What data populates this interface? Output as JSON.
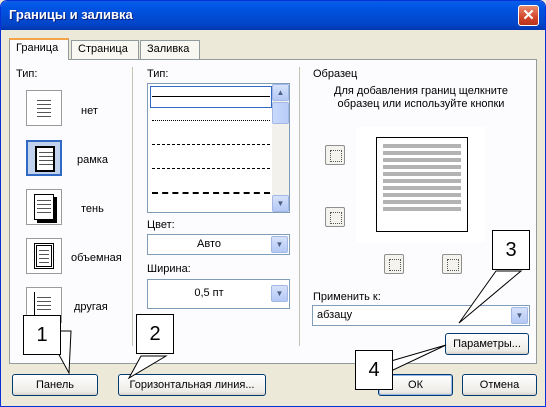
{
  "window": {
    "title": "Границы и заливка",
    "close_glyph": "✕"
  },
  "tabs": [
    {
      "label": "Граница",
      "active": true
    },
    {
      "label": "Страница",
      "active": false
    },
    {
      "label": "Заливка",
      "active": false
    }
  ],
  "setting": {
    "label": "Тип:",
    "items": [
      {
        "label": "нет",
        "icon": "border-none-icon",
        "selected": false
      },
      {
        "label": "рамка",
        "icon": "border-box-icon",
        "selected": true
      },
      {
        "label": "тень",
        "icon": "border-shadow-icon",
        "selected": false
      },
      {
        "label": "объемная",
        "icon": "border-3d-icon",
        "selected": false
      },
      {
        "label": "другая",
        "icon": "border-custom-icon",
        "selected": false
      }
    ]
  },
  "style": {
    "label": "Тип:",
    "line_styles": [
      "solid",
      "dotted",
      "dashed-fine",
      "dashed",
      "dash-dot"
    ],
    "color_label": "Цвет:",
    "color_value": "Авто",
    "width_label": "Ширина:",
    "width_value": "0,5 пт"
  },
  "preview": {
    "label": "Образец",
    "hint": "Для добавления границ щелкните образец или используйте кнопки",
    "apply_label": "Применить к:",
    "apply_value": "абзацу",
    "options_button": "Параметры..."
  },
  "buttons": {
    "panel": "Панель",
    "horizontal_line": "Горизонтальная линия...",
    "ok": "ОК",
    "cancel": "Отмена"
  },
  "callouts": [
    "1",
    "2",
    "3",
    "4"
  ]
}
